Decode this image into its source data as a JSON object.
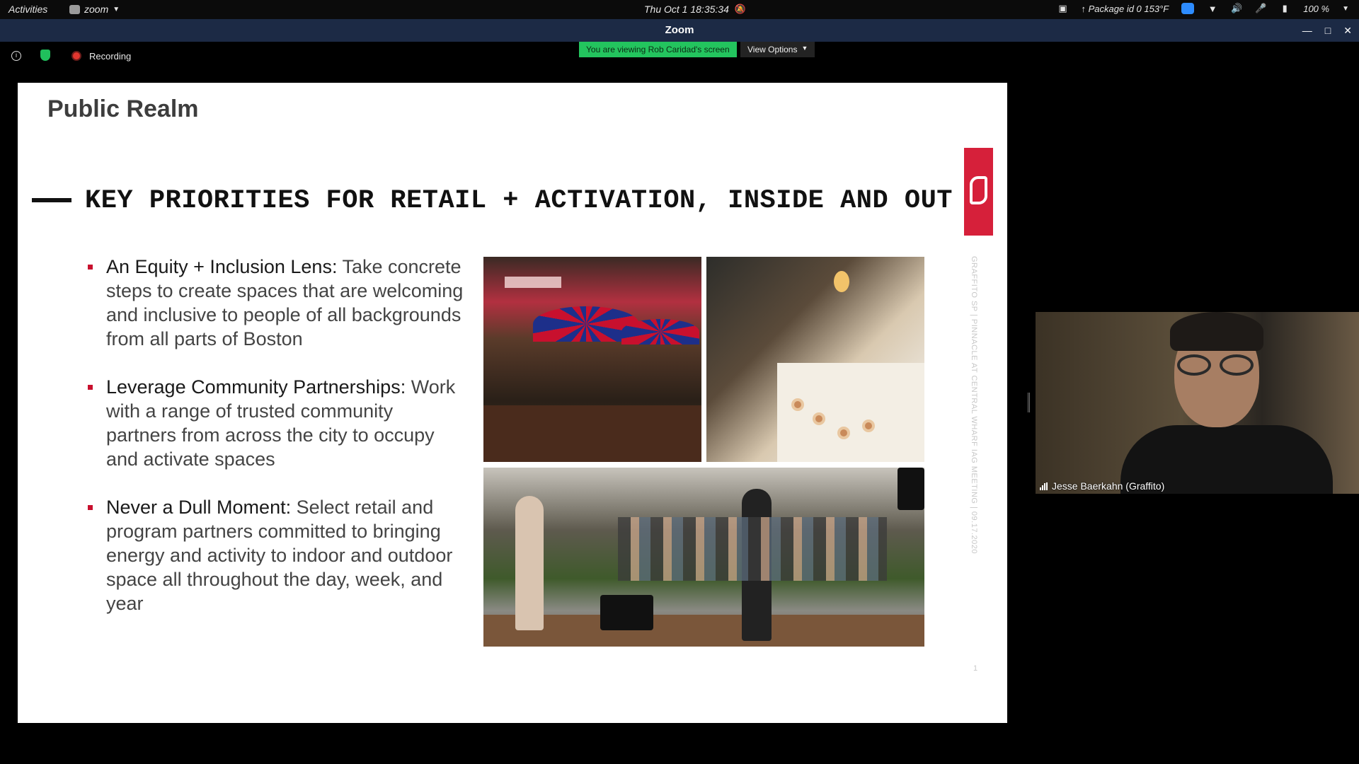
{
  "topbar": {
    "activities": "Activities",
    "app_name": "zoom",
    "clock": "Thu Oct 1  18:35:34",
    "package_info": "↑ Package id 0 153°F",
    "battery": "100 %"
  },
  "window": {
    "title": "Zoom"
  },
  "meeting": {
    "recording_label": "Recording",
    "viewing_banner": "You are viewing Rob Caridad's screen",
    "view_options": "View Options"
  },
  "slide": {
    "title": "Public Realm",
    "headline": "KEY PRIORITIES FOR RETAIL + ACTIVATION, INSIDE AND OUT",
    "side_text": "GRAFFITO SP  |  PINNACLE AT CENTRAL WHARF IAG MEETING  |  09.17.2020",
    "page_number": "1",
    "bullets": [
      {
        "lead": "An Equity + Inclusion Lens:",
        "body": " Take concrete steps to create spaces that are welcoming and inclusive to people of all backgrounds from all parts of Boston"
      },
      {
        "lead": "Leverage Community Partnerships:",
        "body": " Work with a range of trusted community partners from across the city to occupy and activate spaces"
      },
      {
        "lead": "Never a Dull Moment:",
        "body": " Select retail and program partners committed to bringing energy and activity to indoor and outdoor space all throughout the day, week, and year"
      }
    ]
  },
  "participant": {
    "name": "Jesse Baerkahn (Graffito)"
  },
  "colors": {
    "accent_red": "#c8102e",
    "zoom_blue": "#2d8cff",
    "banner_green": "#23c45e"
  }
}
